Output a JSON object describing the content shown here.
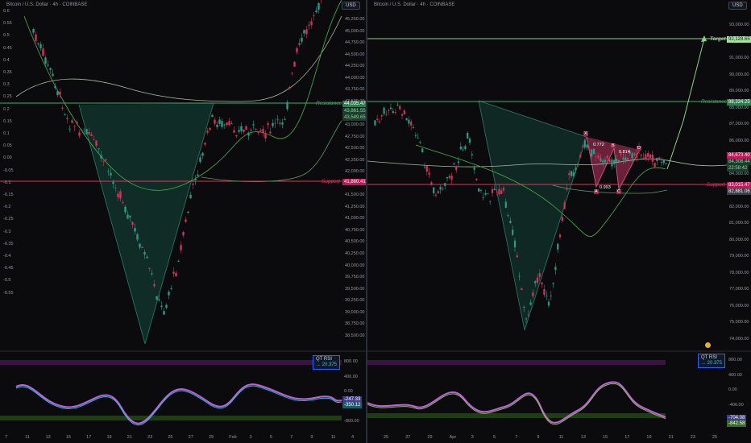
{
  "left": {
    "title": "Bitcoin / U.S. Dollar · 4h · COINBASE",
    "currency_button": "USD",
    "yaxis_labels": [
      "45,250.00",
      "45,000.00",
      "44,750.00",
      "44,500.00",
      "44,250.00",
      "44,000.00",
      "43,750.00",
      "43,500.00",
      "43,250.00",
      "43,000.00",
      "42,750.00",
      "42,500.00",
      "42,250.00",
      "42,000.00",
      "41,750.00",
      "41,500.00",
      "41,250.00",
      "41,000.00",
      "40,750.00",
      "40,500.00",
      "40,250.00",
      "40,000.00",
      "39,750.00",
      "39,500.00",
      "39,250.00",
      "39,000.00",
      "38,750.00",
      "38,500.00"
    ],
    "left_scale_labels": [
      "0.6",
      "0.55",
      "0.5",
      "0.45",
      "0.4",
      "0.35",
      "0.3",
      "0.25",
      "0.2",
      "0.15",
      "0.1",
      "0.05",
      "0.00",
      "-0.05",
      "-0.1",
      "-0.15",
      "-0.2",
      "-0.25",
      "-0.3",
      "-0.35",
      "-0.4",
      "-0.45",
      "-0.5",
      "-0.55"
    ],
    "resistance_label": "Resistance",
    "resistance_price": "44,035.47",
    "support_label": "Support",
    "support_price": "41,860.41",
    "price_tag_1": "43,861.55",
    "price_tag_2": "43,549.65",
    "rsi": {
      "title": "QT RSI",
      "value": "20.375"
    },
    "rsi_axis": [
      "800.00",
      "400.00",
      "0.00",
      "-400.00",
      "-800.00"
    ],
    "rsi_tags": [
      "-247.33",
      "-350.12"
    ],
    "xaxis": [
      "7",
      "11",
      "13",
      "15",
      "17",
      "19",
      "21",
      "23",
      "25",
      "27",
      "29",
      "Feb",
      "3",
      "5",
      "7",
      "9",
      "11",
      "4"
    ]
  },
  "right": {
    "title": "Bitcoin / U.S. Dollar · 4h · COINBASE",
    "currency_button": "USD",
    "yaxis_labels": [
      "93,000.00",
      "92,000.00",
      "91,000.00",
      "90,000.00",
      "89,000.00",
      "88,000.00",
      "87,000.00",
      "86,000.00",
      "85,000.00",
      "84,000.00",
      "83,000.00",
      "82,000.00",
      "81,000.00",
      "80,000.00",
      "79,000.00",
      "78,000.00",
      "77,000.00",
      "76,000.00",
      "75,000.00",
      "74,000.00"
    ],
    "target_label": "Target",
    "target_price": "92,128.65",
    "resistance_label": "Resistance",
    "resistance_price": "88,334.25",
    "support_label": "Support",
    "support_price": "83,015.47",
    "price_tag_1": "84,673.40",
    "price_tag_2": "84,308.44",
    "price_tag_3": "22:58:42",
    "price_tag_4": "82,881.06",
    "pattern_points": [
      "X",
      "A",
      "B",
      "C",
      "D"
    ],
    "pattern_values": [
      "0.772",
      "0.993",
      "0.814"
    ],
    "rsi": {
      "title": "QT RSI",
      "value": "20.375"
    },
    "rsi_axis": [
      "800.00",
      "400.00",
      "0.00",
      "-400.00",
      "-800.00"
    ],
    "rsi_tags": [
      "-704.08",
      "-842.58"
    ],
    "xaxis": [
      "25",
      "27",
      "29",
      "Apr",
      "3",
      "5",
      "7",
      "9",
      "11",
      "13",
      "15",
      "17",
      "19",
      "21",
      "23",
      "25"
    ]
  },
  "colors": {
    "background": "#0b0b0e",
    "resistance": "#3fae6a",
    "support": "#e0365a",
    "target": "#8bd38b",
    "pattern_fill": "#8c2a49",
    "wedge_fill": "#12342d",
    "rsi_upper_band": "#3a1440",
    "rsi_lower_band": "#1f3d12"
  }
}
